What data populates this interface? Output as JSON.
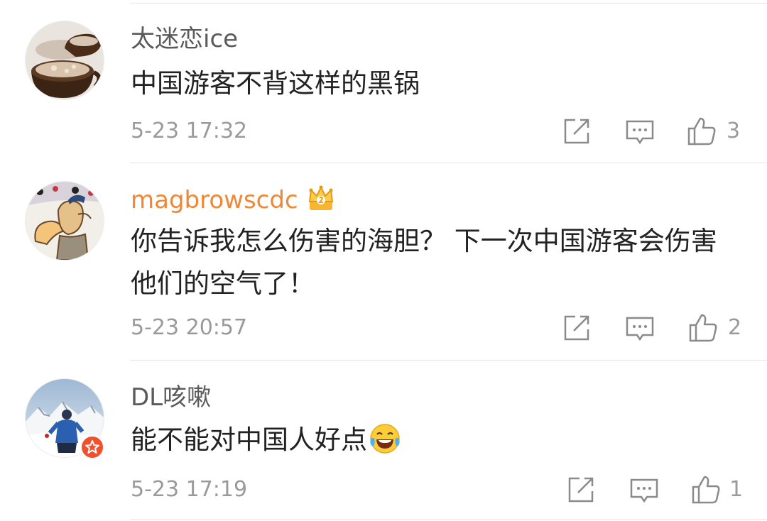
{
  "comments": [
    {
      "username": "太迷恋ice",
      "avatar": "hot-cocoa-cups-avatar",
      "text": "中国游客不背这样的黑锅",
      "time": "5-23 17:32",
      "likes": "3",
      "vip": false
    },
    {
      "username": "magbrowscdc",
      "avatar": "cartoon-character-avatar",
      "badge_icon": "crown-icon",
      "text": "你告诉我怎么伤害的海胆？ 下一次中国游客会伤害他们的空气了！",
      "time": "5-23 20:57",
      "likes": "2",
      "vip": true
    },
    {
      "username": "DL咳嗽",
      "avatar": "mountaineer-avatar",
      "badge_icon": "verified-badge-icon",
      "text": "能不能对中国人好点",
      "emoji": "laughing-tears-emoji",
      "time": "5-23 17:19",
      "likes": "1",
      "vip": false
    }
  ],
  "actions": {
    "repost_icon": "repost-icon",
    "reply_icon": "comment-icon",
    "like_icon": "thumbs-up-icon"
  },
  "colors": {
    "username": "#5a5a5a",
    "vip_username": "#f08734",
    "text": "#222222",
    "meta": "#9a9a9a",
    "divider": "#e6e6e6",
    "badge": "#f0502e"
  }
}
